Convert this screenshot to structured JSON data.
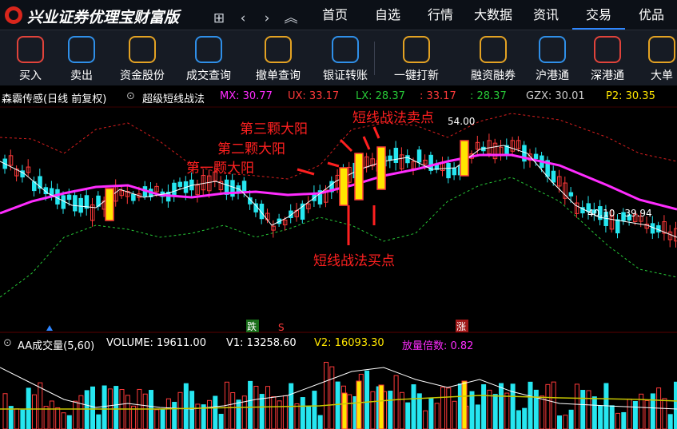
{
  "app": {
    "title": "兴业证券优理宝财富版"
  },
  "nav_icons": [
    {
      "icon": "grid-icon",
      "glyph": "⊞"
    },
    {
      "icon": "back-icon",
      "glyph": "‹"
    },
    {
      "icon": "forward-icon",
      "glyph": "›"
    },
    {
      "icon": "up-double-icon",
      "glyph": "︽"
    }
  ],
  "menu": [
    "首页",
    "自选",
    "行情",
    "大数据",
    "资讯",
    "交易",
    "优品"
  ],
  "menu_active": "交易",
  "toolbar": [
    {
      "label": "买入",
      "icon": "buy-icon",
      "color": "#e0433b"
    },
    {
      "label": "卖出",
      "icon": "sell-icon",
      "color": "#2f8fe8"
    },
    {
      "label": "资金股份",
      "icon": "fund-coin-icon",
      "color": "#e3a223"
    },
    {
      "label": "成交查询",
      "icon": "deal-query-icon",
      "color": "#2f8fe8"
    },
    {
      "label": "撤单查询",
      "icon": "cancel-query-icon",
      "color": "#e3a223"
    },
    {
      "label": "银证转账",
      "icon": "bank-transfer-icon",
      "color": "#2f8fe8"
    },
    {
      "label": "一键打新",
      "icon": "ipo-icon",
      "color": "#e3a223"
    },
    {
      "label": "融资融券",
      "icon": "margin-icon",
      "color": "#e3a223"
    },
    {
      "label": "沪港通",
      "icon": "sh-hk-icon",
      "color": "#2f8fe8"
    },
    {
      "label": "深港通",
      "icon": "sz-hk-icon",
      "color": "#e0433b"
    },
    {
      "label": "大单",
      "icon": "big-order-icon",
      "color": "#e3a223"
    }
  ],
  "info": {
    "stock": "森霸传感(日线 前复权)",
    "indicator": "超级短线战法",
    "mx": "MX: 30.77",
    "ux": "UX: 33.17",
    "lx": "LX: 28.37",
    "v4": ": 33.17",
    "v5": ": 28.37",
    "gzx": "GZX: 30.01",
    "p2": "P2: 30.35"
  },
  "annotations": {
    "sell_point": "短线战法卖点",
    "third": "第三颗大阳",
    "second": "第二颗大阳",
    "first": "第一颗大阳",
    "buy_point": "短线战法买点"
  },
  "chart_labels": {
    "high": "54.00",
    "range": "40.10 - 39.94",
    "down_tag": "跌",
    "up_tag": "涨",
    "s_tag": "S"
  },
  "volume": {
    "name": "AA成交量(5,60)",
    "volume": "VOLUME: 19611.00",
    "v1": "V1: 13258.60",
    "v2": "V2: 16093.30",
    "ratio": "放量倍数: 0.82"
  },
  "colors": {
    "up": "#ff3a3a",
    "down": "#26e6f0",
    "ma_magenta": "#ff2cff",
    "ma_white": "#ffffff",
    "band_red": "#d81e1e",
    "band_green": "#27c837",
    "highlight": "#ffe600",
    "vol_yellow": "#c8c800"
  }
}
